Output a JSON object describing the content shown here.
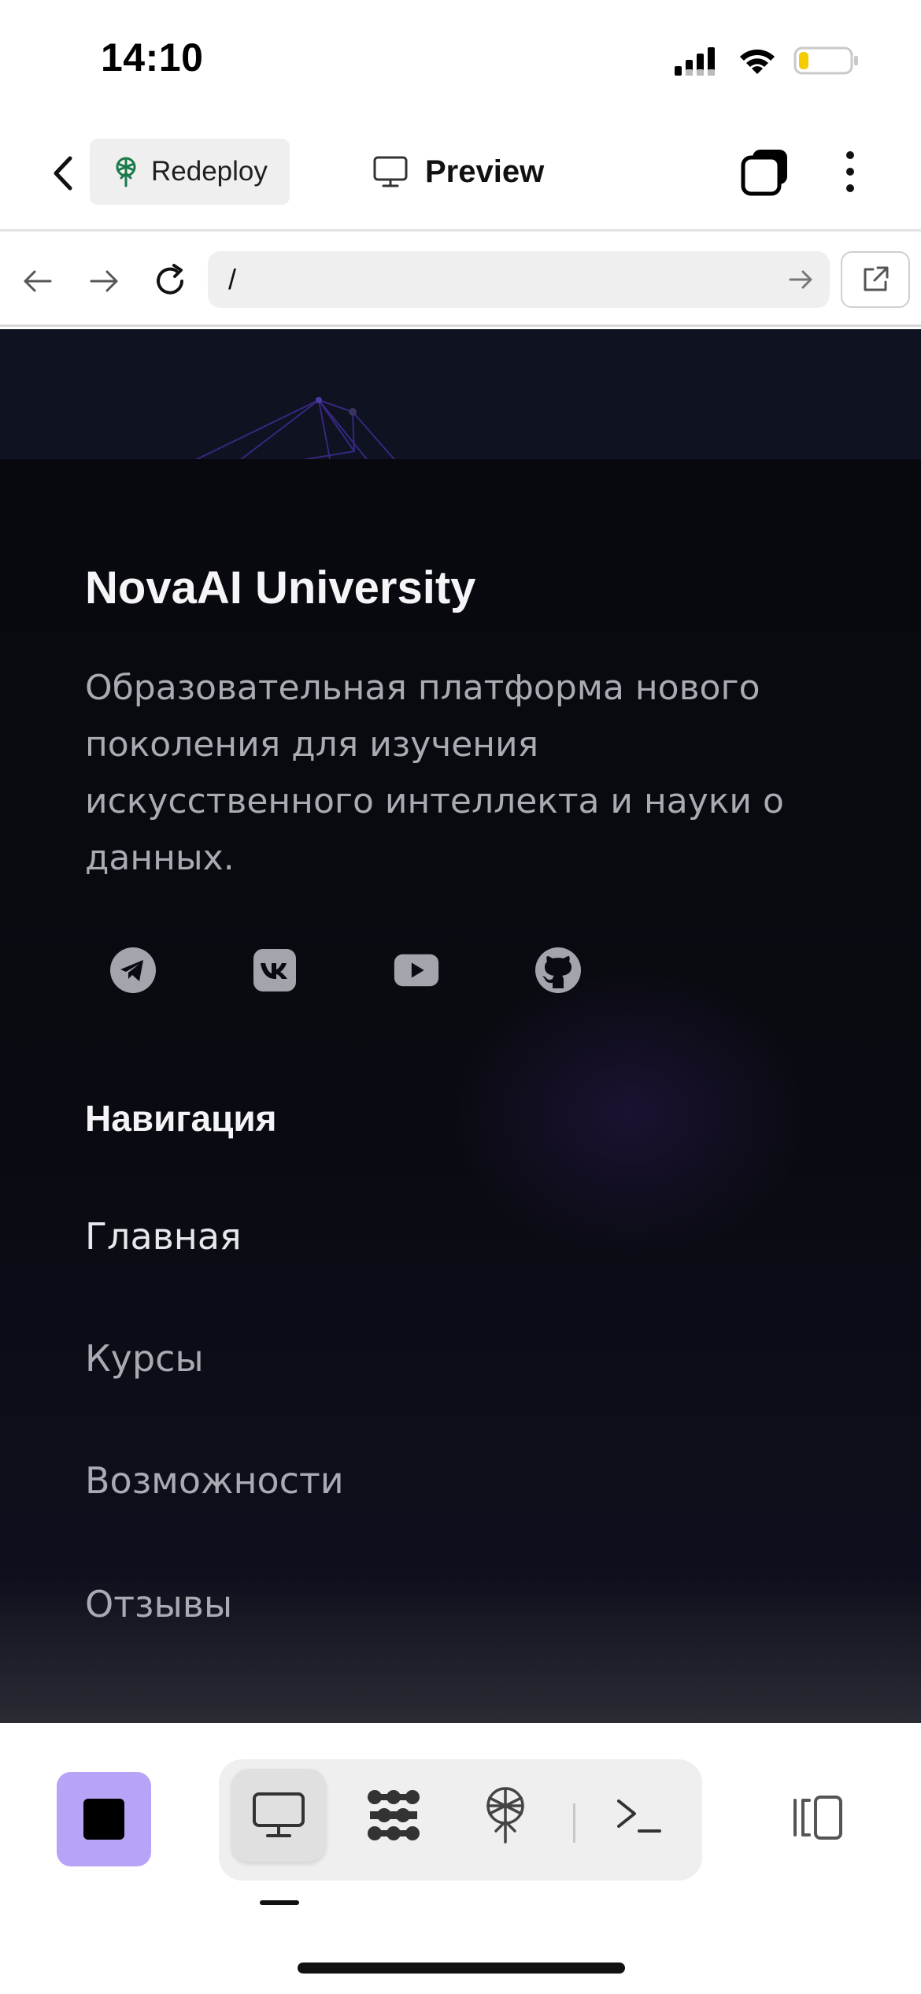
{
  "status_bar": {
    "time": "14:10"
  },
  "app_bar": {
    "redeploy_label": "Redeploy",
    "preview_label": "Preview"
  },
  "browser": {
    "url": "/"
  },
  "page": {
    "brand": "NovaAI University",
    "description": "Образовательная платформа нового поколения для изучения искусственного интеллекта и науки о данных.",
    "socials": [
      "telegram-icon",
      "vk-icon",
      "youtube-icon",
      "github-icon"
    ],
    "nav_heading": "Навигация",
    "nav_links": [
      "Главная",
      "Курсы",
      "Возможности",
      "Отзывы"
    ]
  },
  "colors": {
    "accent": "#b7a4f7",
    "page_bg": "#0a0b12",
    "battery_level": "#f5cc00"
  },
  "battery_fraction": 0.2
}
